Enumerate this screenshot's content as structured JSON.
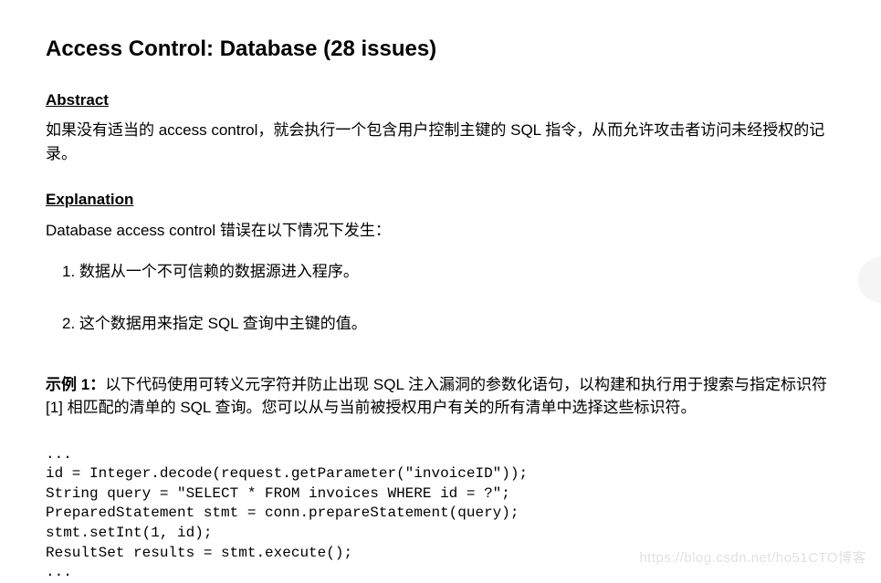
{
  "title": "Access Control: Database (28 issues)",
  "abstract": {
    "heading": "Abstract",
    "body": "如果没有适当的 access control，就会执行一个包含用户控制主键的 SQL 指令，从而允许攻击者访问未经授权的记录。"
  },
  "explanation": {
    "heading": "Explanation",
    "intro": "Database access control 错误在以下情况下发生：",
    "items": [
      "1. 数据从一个不可信赖的数据源进入程序。",
      "2. 这个数据用来指定 SQL 查询中主键的值。"
    ],
    "example_label": "示例 1：",
    "example_text": "以下代码使用可转义元字符并防止出现 SQL 注入漏洞的参数化语句，以构建和执行用于搜索与指定标识符 [1] 相匹配的清单的 SQL 查询。您可以从与当前被授权用户有关的所有清单中选择这些标识符。",
    "code": "...\nid = Integer.decode(request.getParameter(\"invoiceID\"));\nString query = \"SELECT * FROM invoices WHERE id = ?\";\nPreparedStatement stmt = conn.prepareStatement(query);\nstmt.setInt(1, id);\nResultSet results = stmt.execute();\n..."
  },
  "watermark": "https://blog.csdn.net/ho51CTO博客"
}
